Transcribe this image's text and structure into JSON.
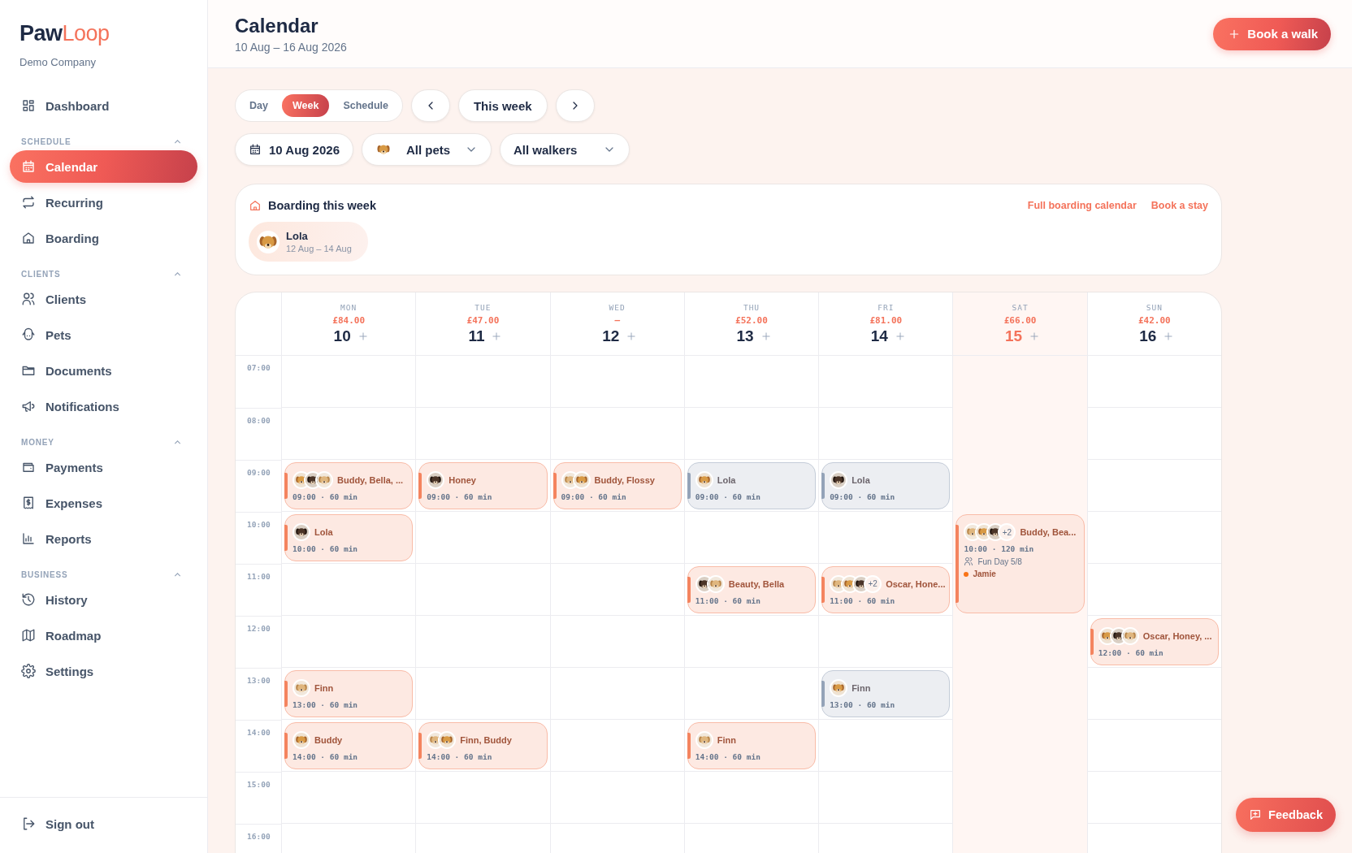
{
  "sidebar": {
    "logo_dark": "Paw",
    "logo_accent": "Loop",
    "company": "Demo Company",
    "items": [
      {
        "label": "Dashboard",
        "selected": false
      }
    ],
    "sections": [
      {
        "title": "SCHEDULE",
        "expanded": true,
        "items": [
          {
            "label": "Calendar",
            "selected": true
          },
          {
            "label": "Recurring",
            "selected": false
          },
          {
            "label": "Boarding",
            "selected": false
          }
        ]
      },
      {
        "title": "CLIENTS",
        "expanded": true,
        "items": [
          {
            "label": "Clients",
            "selected": false
          },
          {
            "label": "Pets",
            "selected": false
          },
          {
            "label": "Documents",
            "selected": false
          },
          {
            "label": "Notifications",
            "selected": false
          }
        ]
      },
      {
        "title": "MONEY",
        "expanded": true,
        "items": [
          {
            "label": "Payments",
            "selected": false
          },
          {
            "label": "Expenses",
            "selected": false
          },
          {
            "label": "Reports",
            "selected": false
          }
        ]
      },
      {
        "title": "BUSINESS",
        "expanded": true,
        "items": [
          {
            "label": "History",
            "selected": false
          },
          {
            "label": "Roadmap",
            "selected": false
          },
          {
            "label": "Settings",
            "selected": false
          }
        ]
      }
    ],
    "sign_out": "Sign out"
  },
  "header": {
    "title": "Calendar",
    "subtitle": "10 Aug – 16 Aug 2026",
    "action": "Book a walk"
  },
  "view_tabs": [
    {
      "label": "Day",
      "selected": false
    },
    {
      "label": "Week",
      "selected": true
    },
    {
      "label": "Schedule",
      "selected": false
    }
  ],
  "this_week": "This week",
  "filters": {
    "date": "10 Aug 2026",
    "pets": "All pets",
    "walkers": "All walkers"
  },
  "boarding": {
    "title": "Boarding this week",
    "links": [
      "Full boarding calendar",
      "Book a stay"
    ],
    "stays": [
      {
        "name": "Lola",
        "dates": "12 Aug – 14 Aug"
      }
    ]
  },
  "calendar": {
    "hours": [
      "07:00",
      "08:00",
      "09:00",
      "10:00",
      "11:00",
      "12:00",
      "13:00",
      "14:00",
      "15:00",
      "16:00"
    ],
    "days": [
      {
        "dow": "MON",
        "revenue": "£84.00",
        "date": "10",
        "today": false,
        "events": [
          {
            "title": "Buddy, Bella, ...",
            "when": "09:00 · 60 min",
            "color": "#f4845f"
          },
          {
            "title": "Lola",
            "when": "10:00 · 60 min",
            "color": "#f4845f"
          },
          {
            "title": "Finn",
            "when": "13:00 · 60 min",
            "color": "#f4845f"
          },
          {
            "title": "Buddy",
            "when": "14:00 · 60 min",
            "color": "#f4845f"
          }
        ]
      },
      {
        "dow": "TUE",
        "revenue": "£47.00",
        "date": "11",
        "today": false,
        "events": [
          {
            "title": "Honey",
            "when": "09:00 · 60 min",
            "color": "#f4845f"
          },
          {
            "title": "Finn, Buddy",
            "when": "14:00 · 60 min",
            "color": "#f4845f"
          }
        ]
      },
      {
        "dow": "WED",
        "revenue": "–",
        "date": "12",
        "today": false,
        "events": [
          {
            "title": "Buddy, Flossy",
            "when": "09:00 · 60 min",
            "color": "#f4845f"
          }
        ]
      },
      {
        "dow": "THU",
        "revenue": "£52.00",
        "date": "13",
        "today": false,
        "events": [
          {
            "title": "Lola",
            "when": "09:00 · 60 min",
            "color": "#94a3b8"
          },
          {
            "title": "Beauty, Bella",
            "when": "11:00 · 60 min",
            "color": "#f4845f"
          },
          {
            "title": "Finn",
            "when": "14:00 · 60 min",
            "color": "#f4845f"
          }
        ]
      },
      {
        "dow": "FRI",
        "revenue": "£81.00",
        "date": "14",
        "today": false,
        "events": [
          {
            "title": "Lola",
            "when": "09:00 · 60 min",
            "color": "#94a3b8"
          },
          {
            "title": "Oscar, Hone...",
            "when": "11:00 · 60 min",
            "color": "#f4845f",
            "more": "+2"
          },
          {
            "title": "Finn",
            "when": "13:00 · 60 min",
            "color": "#94a3b8"
          }
        ]
      },
      {
        "dow": "SAT",
        "revenue": "£66.00",
        "date": "15",
        "today": true,
        "events": [
          {
            "title": "Buddy, Bea...",
            "when": "10:00 · 120 min",
            "color": "#f4845f",
            "more": "+2",
            "group": "Fun Day 5/8",
            "walker": {
              "name": "Jamie",
              "color": "#f97316"
            }
          }
        ]
      },
      {
        "dow": "SUN",
        "revenue": "£42.00",
        "date": "16",
        "today": false,
        "events": [
          {
            "title": "Oscar, Honey, ...",
            "when": "12:00 · 60 min",
            "color": "#f4845f"
          }
        ]
      }
    ]
  },
  "feedback": "Feedback"
}
